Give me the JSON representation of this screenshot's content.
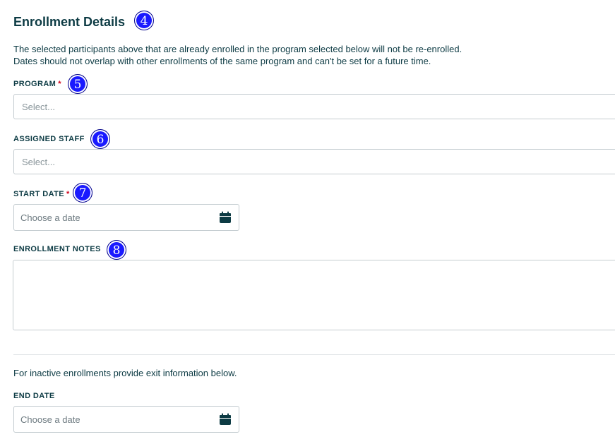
{
  "section": {
    "title": "Enrollment Details",
    "badge": "4",
    "description_line1": "The selected participants above that are already enrolled in the program selected below will not be re-enrolled.",
    "description_line2": "Dates should not overlap with other enrollments of the same program and can't be set for a future time."
  },
  "program": {
    "label": "PROGRAM",
    "required_mark": "*",
    "badge": "5",
    "placeholder": "Select..."
  },
  "assigned_staff": {
    "label": "ASSIGNED STAFF",
    "badge": "6",
    "placeholder": "Select..."
  },
  "start_date": {
    "label": "START DATE",
    "required_mark": "*",
    "badge": "7",
    "placeholder": "Choose a date"
  },
  "enrollment_notes": {
    "label": "ENROLLMENT NOTES",
    "badge": "8",
    "value": ""
  },
  "exit_info": {
    "description": "For inactive enrollments provide exit information below."
  },
  "end_date": {
    "label": "END DATE",
    "placeholder": "Choose a date"
  },
  "colors": {
    "text": "#0d3b44",
    "required": "#d0021b",
    "badge": "#1a1aff",
    "border": "#c4ccd0"
  },
  "icons": {
    "date_picker": "calendar-icon"
  }
}
